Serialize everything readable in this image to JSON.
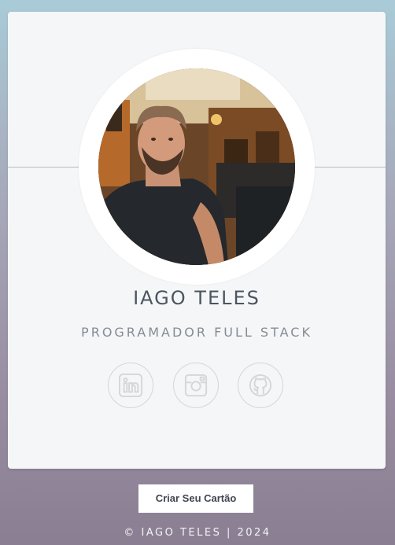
{
  "profile": {
    "name": "IAGO TELES",
    "role": "PROGRAMADOR FULL STACK"
  },
  "socials": [
    {
      "icon": "linkedin-icon"
    },
    {
      "icon": "instagram-icon"
    },
    {
      "icon": "github-icon"
    }
  ],
  "cta": {
    "label": "Criar Seu Cartão"
  },
  "footer": {
    "text": "© IAGO TELES | 2024"
  },
  "colors": {
    "card_background": "#f5f6f7",
    "name_text": "#4b5560",
    "role_text": "#858c94",
    "icon_stroke": "#d3d6da",
    "footer_text": "#f3f3f5"
  }
}
